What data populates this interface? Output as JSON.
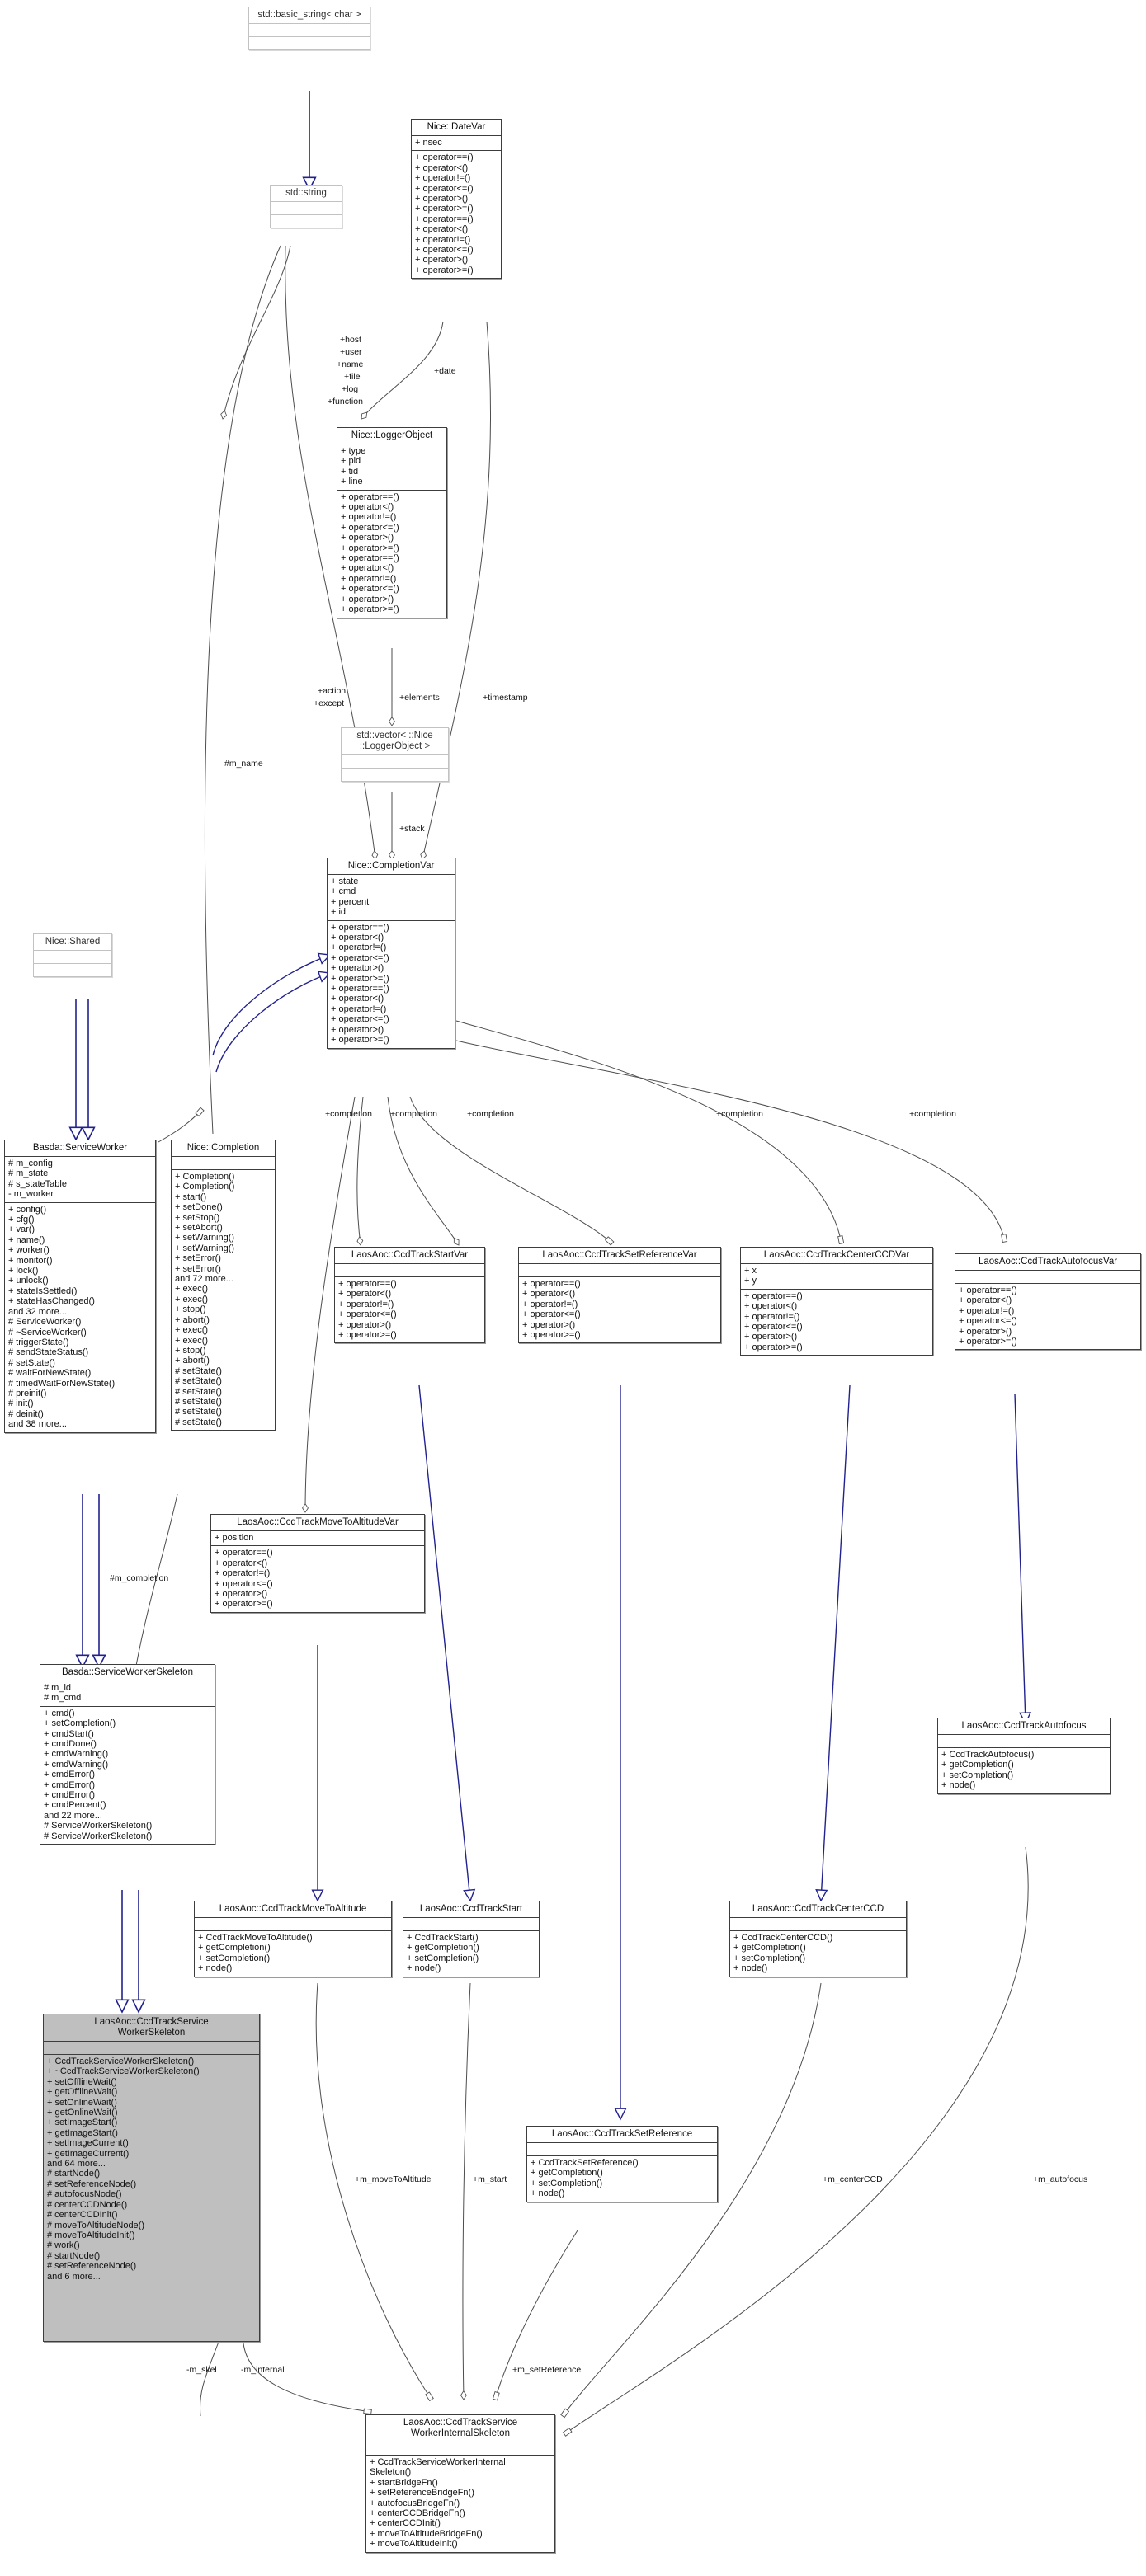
{
  "diagram": {
    "kind": "uml-class-diagram",
    "colors": {
      "inheritance_edge": "#22228f",
      "association_edge": "#4d4d4d",
      "highlight_fill": "#bfbfbf",
      "box_border": "#3d3d3d",
      "external_border": "#c2c2c2"
    }
  },
  "classes": {
    "basic_string": {
      "name": "std::basic_string< char >",
      "attributes": [],
      "methods": []
    },
    "string": {
      "name": "std::string",
      "attributes": [],
      "methods": []
    },
    "datevar": {
      "name": "Nice::DateVar",
      "attributes": [
        "+ nsec"
      ],
      "methods": [
        "+ operator==()",
        "+ operator<()",
        "+ operator!=()",
        "+ operator<=()",
        "+ operator>()",
        "+ operator>=()",
        "+ operator==()",
        "+ operator<()",
        "+ operator!=()",
        "+ operator<=()",
        "+ operator>()",
        "+ operator>=()"
      ]
    },
    "loggerobject": {
      "name": "Nice::LoggerObject",
      "attributes": [
        "+ type",
        "+ pid",
        "+ tid",
        "+ line"
      ],
      "methods": [
        "+ operator==()",
        "+ operator<()",
        "+ operator!=()",
        "+ operator<=()",
        "+ operator>()",
        "+ operator>=()",
        "+ operator==()",
        "+ operator<()",
        "+ operator!=()",
        "+ operator<=()",
        "+ operator>()",
        "+ operator>=()"
      ]
    },
    "vector_loggerobject": {
      "name": "std::vector< ::Nice ::LoggerObject >",
      "attributes": [],
      "methods": []
    },
    "completionvar": {
      "name": "Nice::CompletionVar",
      "attributes": [
        "+ state",
        "+ cmd",
        "+ percent",
        "+ id"
      ],
      "methods": [
        "+ operator==()",
        "+ operator<()",
        "+ operator!=()",
        "+ operator<=()",
        "+ operator>()",
        "+ operator>=()",
        "+ operator==()",
        "+ operator<()",
        "+ operator!=()",
        "+ operator<=()",
        "+ operator>()",
        "+ operator>=()"
      ]
    },
    "shared": {
      "name": "Nice::Shared",
      "attributes": [],
      "methods": []
    },
    "serviceworker": {
      "name": "Basda::ServiceWorker",
      "attributes": [
        "# m_config",
        "# m_state",
        "# s_stateTable",
        "- m_worker"
      ],
      "methods": [
        "+ config()",
        "+ cfg()",
        "+ var()",
        "+ name()",
        "+ worker()",
        "+ monitor()",
        "+ lock()",
        "+ unlock()",
        "+ stateIsSettled()",
        "+ stateHasChanged()",
        "and 32 more...",
        "# ServiceWorker()",
        "# ~ServiceWorker()",
        "# triggerState()",
        "# sendStateStatus()",
        "# setState()",
        "# waitForNewState()",
        "# timedWaitForNewState()",
        "# preinit()",
        "# init()",
        "# deinit()",
        "and 38 more..."
      ]
    },
    "completion": {
      "name": "Nice::Completion",
      "attributes": [],
      "methods": [
        "+ Completion()",
        "+ Completion()",
        "+ start()",
        "+ setDone()",
        "+ setStop()",
        "+ setAbort()",
        "+ setWarning()",
        "+ setWarning()",
        "+ setError()",
        "+ setError()",
        "and 72 more...",
        "+ exec()",
        "+ exec()",
        "+ stop()",
        "+ abort()",
        "+ exec()",
        "+ exec()",
        "+ stop()",
        "+ abort()",
        "# setState()",
        "# setState()",
        "# setState()",
        "# setState()",
        "# setState()",
        "# setState()"
      ]
    },
    "startvar": {
      "name": "LaosAoc::CcdTrackStartVar",
      "attributes": [],
      "methods": [
        "+ operator==()",
        "+ operator<()",
        "+ operator!=()",
        "+ operator<=()",
        "+ operator>()",
        "+ operator>=()"
      ]
    },
    "setreferencevar": {
      "name": "LaosAoc::CcdTrackSetReferenceVar",
      "attributes": [],
      "methods": [
        "+ operator==()",
        "+ operator<()",
        "+ operator!=()",
        "+ operator<=()",
        "+ operator>()",
        "+ operator>=()"
      ]
    },
    "centerccdvar": {
      "name": "LaosAoc::CcdTrackCenterCCDVar",
      "attributes": [
        "+ x",
        "+ y"
      ],
      "methods": [
        "+ operator==()",
        "+ operator<()",
        "+ operator!=()",
        "+ operator<=()",
        "+ operator>()",
        "+ operator>=()"
      ]
    },
    "autofocusvar": {
      "name": "LaosAoc::CcdTrackAutofocusVar",
      "attributes": [],
      "methods": [
        "+ operator==()",
        "+ operator<()",
        "+ operator!=()",
        "+ operator<=()",
        "+ operator>()",
        "+ operator>=()"
      ]
    },
    "movetoaltitudevar": {
      "name": "LaosAoc::CcdTrackMoveToAltitudeVar",
      "attributes": [
        "+ position"
      ],
      "methods": [
        "+ operator==()",
        "+ operator<()",
        "+ operator!=()",
        "+ operator<=()",
        "+ operator>()",
        "+ operator>=()"
      ]
    },
    "serviceworkerskeleton": {
      "name": "Basda::ServiceWorkerSkeleton",
      "attributes": [
        "# m_id",
        "# m_cmd"
      ],
      "methods": [
        "+ cmd()",
        "+ setCompletion()",
        "+ cmdStart()",
        "+ cmdDone()",
        "+ cmdWarning()",
        "+ cmdWarning()",
        "+ cmdError()",
        "+ cmdError()",
        "+ cmdError()",
        "+ cmdPercent()",
        "and 22 more...",
        "# ServiceWorkerSkeleton()",
        "# ServiceWorkerSkeleton()"
      ]
    },
    "autofocus": {
      "name": "LaosAoc::CcdTrackAutofocus",
      "attributes": [],
      "methods": [
        "+ CcdTrackAutofocus()",
        "+ getCompletion()",
        "+ setCompletion()",
        "+ node()"
      ]
    },
    "movetoaltitude": {
      "name": "LaosAoc::CcdTrackMoveToAltitude",
      "attributes": [],
      "methods": [
        "+ CcdTrackMoveToAltitude()",
        "+ getCompletion()",
        "+ setCompletion()",
        "+ node()"
      ]
    },
    "start": {
      "name": "LaosAoc::CcdTrackStart",
      "attributes": [],
      "methods": [
        "+ CcdTrackStart()",
        "+ getCompletion()",
        "+ setCompletion()",
        "+ node()"
      ]
    },
    "centerccd": {
      "name": "LaosAoc::CcdTrackCenterCCD",
      "attributes": [],
      "methods": [
        "+ CcdTrackCenterCCD()",
        "+ getCompletion()",
        "+ setCompletion()",
        "+ node()"
      ]
    },
    "setreference": {
      "name": "LaosAoc::CcdTrackSetReference",
      "attributes": [],
      "methods": [
        "+ CcdTrackSetReference()",
        "+ getCompletion()",
        "+ setCompletion()",
        "+ node()"
      ]
    },
    "ccdtrackskeleton": {
      "name": "LaosAoc::CcdTrackService WorkerSkeleton",
      "name_line1": "LaosAoc::CcdTrackService",
      "name_line2": "WorkerSkeleton",
      "attributes": [],
      "methods": [
        "+ CcdTrackServiceWorkerSkeleton()",
        "+ ~CcdTrackServiceWorkerSkeleton()",
        "+ setOfflineWait()",
        "+ getOfflineWait()",
        "+ setOnlineWait()",
        "+ getOnlineWait()",
        "+ setImageStart()",
        "+ getImageStart()",
        "+ setImageCurrent()",
        "+ getImageCurrent()",
        "and 64 more...",
        "# startNode()",
        "# setReferenceNode()",
        "# autofocusNode()",
        "# centerCCDNode()",
        "# centerCCDInit()",
        "# moveToAltitudeNode()",
        "# moveToAltitudeInit()",
        "# work()",
        "# startNode()",
        "# setReferenceNode()",
        "and 6 more..."
      ]
    },
    "ccdtrackinternalskeleton": {
      "name": "LaosAoc::CcdTrackService WorkerInternalSkeleton",
      "name_line1": "LaosAoc::CcdTrackService",
      "name_line2": "WorkerInternalSkeleton",
      "attributes": [],
      "methods": [
        "+ CcdTrackServiceWorkerInternal",
        "Skeleton()",
        "+ startBridgeFn()",
        "+ setReferenceBridgeFn()",
        "+ autofocusBridgeFn()",
        "+ centerCCDBridgeFn()",
        "+ centerCCDInit()",
        "+ moveToAltitudeBridgeFn()",
        "+ moveToAltitudeInit()"
      ]
    }
  },
  "edge_labels": {
    "host_user_name_file_log_function": "+host\n+user\n+name\n+file\n+log\n+function",
    "host": "+host",
    "user": "+user",
    "name": "+name",
    "file": "+file",
    "log": "+log",
    "function": "+function",
    "date": "+date",
    "action": "+action",
    "except": "+except",
    "elements": "+elements",
    "timestamp": "+timestamp",
    "stack": "+stack",
    "m_name": "#m_name",
    "m_completion": "#m_completion",
    "completion1": "+completion",
    "completion2": "+completion",
    "completion3": "+completion",
    "completion4": "+completion",
    "completion5": "+completion",
    "m_skel": "-m_skel",
    "m_internal": "-m_internal",
    "m_moveToAltitude": "+m_moveToAltitude",
    "m_start": "+m_start",
    "m_setReference": "+m_setReference",
    "m_centerCCD": "+m_centerCCD",
    "m_autofocus": "+m_autofocus"
  }
}
